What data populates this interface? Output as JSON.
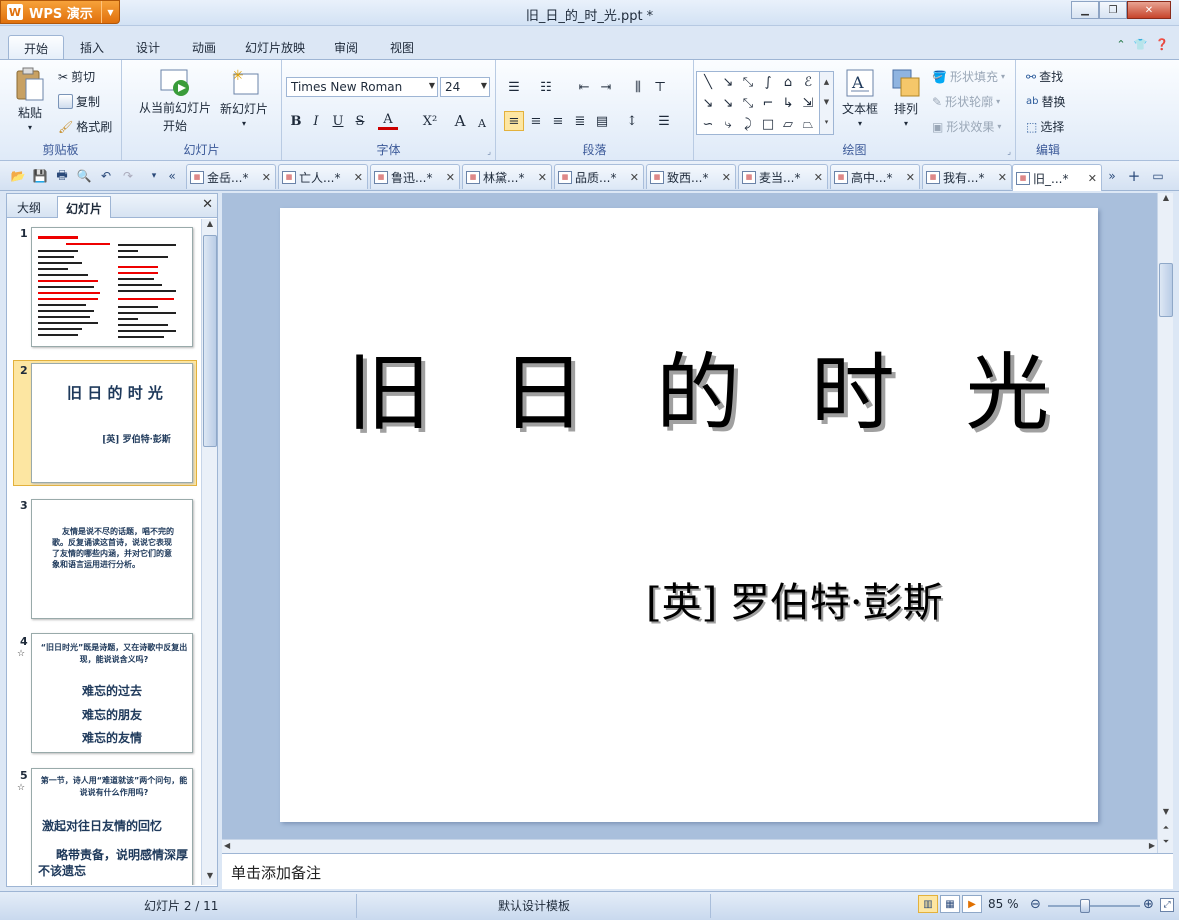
{
  "app": {
    "name": "WPS 演示",
    "logo": "W"
  },
  "window": {
    "title": "旧_日_的_时_光.ppt *"
  },
  "menu_tabs": [
    "开始",
    "插入",
    "设计",
    "动画",
    "幻灯片放映",
    "审阅",
    "视图"
  ],
  "ribbon": {
    "clipboard": {
      "group": "剪贴板",
      "paste": "粘贴",
      "cut": "剪切",
      "copy": "复制",
      "format_painter": "格式刷"
    },
    "slides": {
      "group": "幻灯片",
      "from_current_1": "从当前幻灯片",
      "from_current_2": "开始",
      "new_slide": "新幻灯片"
    },
    "font": {
      "group": "字体",
      "font_name": "Times New Roman",
      "font_size": "24",
      "bold": "B",
      "italic": "I",
      "underline": "U",
      "strike": "S",
      "font_color": "A",
      "superscript": "X²",
      "grow": "A",
      "shrink": "A"
    },
    "paragraph": {
      "group": "段落"
    },
    "drawing": {
      "group": "绘图",
      "textbox": "文本框",
      "arrange": "排列",
      "shape_fill": "形状填充",
      "shape_outline": "形状轮廓",
      "shape_effect": "形状效果"
    },
    "editing": {
      "group": "编辑",
      "find": "查找",
      "replace": "替换",
      "select": "选择"
    }
  },
  "doc_tabs": [
    {
      "label": "金岳...*"
    },
    {
      "label": "亡人...*"
    },
    {
      "label": "鲁迅...*"
    },
    {
      "label": "林黛...*"
    },
    {
      "label": "品质...*"
    },
    {
      "label": "致西...*"
    },
    {
      "label": "麦当...*"
    },
    {
      "label": "高中...*"
    },
    {
      "label": "我有...*"
    },
    {
      "label": "旧_...*"
    }
  ],
  "left_panel": {
    "tab_outline": "大纲",
    "tab_slides": "幻灯片",
    "slides": [
      {
        "num": "1"
      },
      {
        "num": "2",
        "title": "旧 日 的 时 光",
        "subtitle": "[英]  罗伯特·彭斯"
      },
      {
        "num": "3",
        "text": "友情是说不尽的话题，唱不完的歌。反复诵读这首诗，说说它表现了友情的哪些内涵，并对它们的意象和语言运用进行分析。"
      },
      {
        "num": "4",
        "star": "☆",
        "q": "“旧日时光”既是诗题，又在诗歌中反复出现，能说说含义吗?",
        "a1": "难忘的过去",
        "a2": "难忘的朋友",
        "a3": "难忘的友情"
      },
      {
        "num": "5",
        "star": "☆",
        "q": "第一节，诗人用“难道就该”两个问句，能说说有什么作用吗?",
        "a1": "激起对往日友情的回忆",
        "a2": "略带责备，说明感情深厚不该遗忘"
      }
    ]
  },
  "slide": {
    "title": "旧 日 的 时 光",
    "subtitle": "[英]  罗伯特·彭斯"
  },
  "notes": {
    "placeholder": "单击添加备注"
  },
  "status": {
    "slide_index": "幻灯片 2 / 11",
    "template": "默认设计模板",
    "zoom": "85 %"
  }
}
